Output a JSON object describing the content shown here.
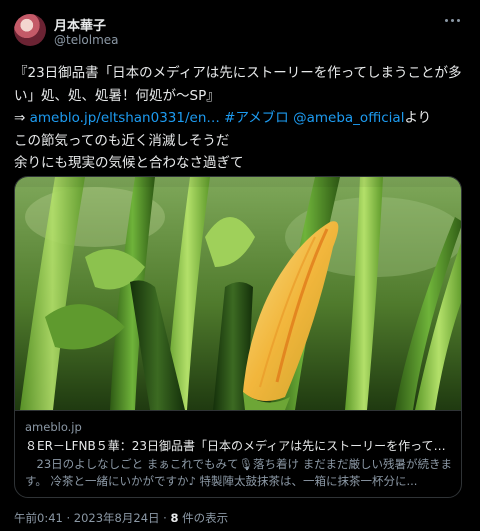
{
  "author": {
    "display_name": "月本華子",
    "handle": "@telolmea"
  },
  "tweet": {
    "line1": "『23日御品書「日本のメディアは先にストーリーを作ってしまうことが多",
    "line2": "い」処、処、処暑！何処が〜SP』",
    "arrow": "⇒ ",
    "link_url": "ameblo.jp/eltshan0331/en…",
    "hashtag": "#アメブロ",
    "mention": "@ameba_official",
    "mention_suffix": "より",
    "line4": "この節気ってのも近く消滅しそうだ",
    "line5": "余りにも現実の気候と合わなさ過ぎて"
  },
  "card": {
    "domain": "ameblo.jp",
    "title": "８ER－LFNB５華：23日御品書「日本のメディアは先にストーリーを作ってし...",
    "description": "　23日のよしなしごと まぁこれでもみて🎙落ち着け まだまだ厳しい残暑が続きます。 冷茶と一緒にいかがですか♪ 特製陣太鼓抹茶は、一箱に抹茶一杯分に..."
  },
  "footer": {
    "timestamp": "午前0:41 · 2023年8月24日 · ",
    "views_count": "8",
    "views_label": " 件の表示"
  },
  "colors": {
    "background": "#000000",
    "text": "#e7e9ea",
    "muted": "#8b98a5",
    "link": "#1d9bf0",
    "border": "#2f3336"
  },
  "icons": {
    "more": "more-horizontal-icon"
  }
}
